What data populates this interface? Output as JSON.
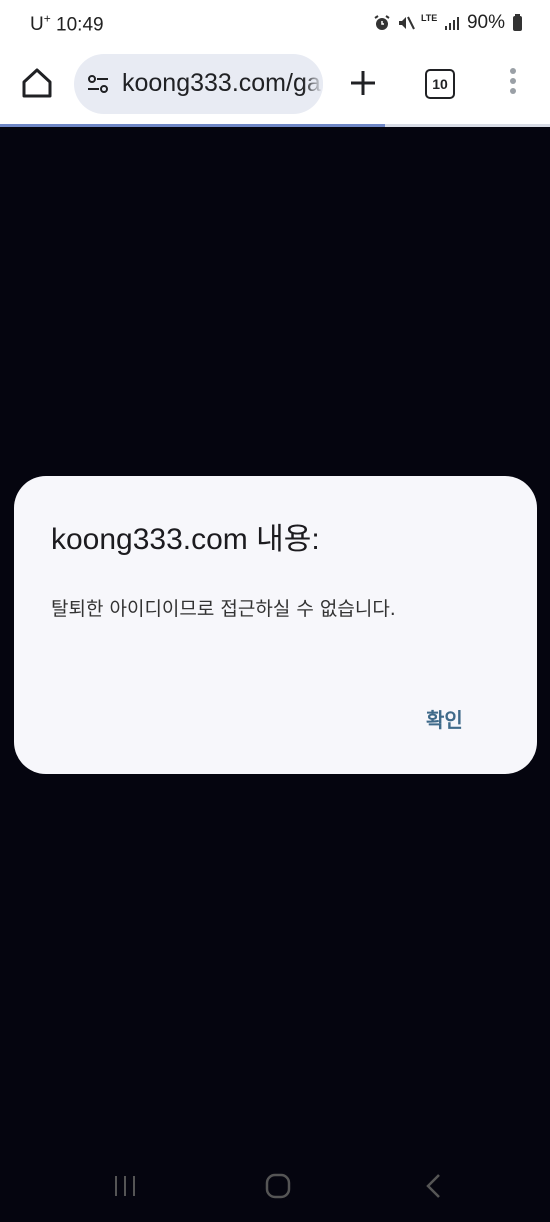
{
  "status": {
    "carrier": "U",
    "carrier_sup": "+",
    "time": "10:49",
    "network": "LTE",
    "battery": "90%"
  },
  "browser": {
    "url": "koong333.com/ga",
    "tab_count": "10",
    "progress": 0.7
  },
  "dialog": {
    "title": "koong333.com 내용:",
    "message": "탈퇴한 아이디이므로 접근하실 수 없습니다.",
    "ok_label": "확인"
  },
  "icons": {
    "home": "home-icon",
    "site_settings": "tune-icon",
    "new_tab": "plus-icon",
    "tabs": "tab-switcher-icon",
    "menu": "more-vert-icon",
    "alarm": "alarm-icon",
    "mute": "mute-icon",
    "signal": "signal-icon",
    "battery": "battery-icon",
    "nav_recent": "recent-apps-icon",
    "nav_home": "nav-home-icon",
    "nav_back": "back-icon"
  },
  "colors": {
    "page_background": "#05050f",
    "dialog_background": "#f7f7fb",
    "accent": "#3f6a8a",
    "urlbar": "#e8ebf3"
  }
}
